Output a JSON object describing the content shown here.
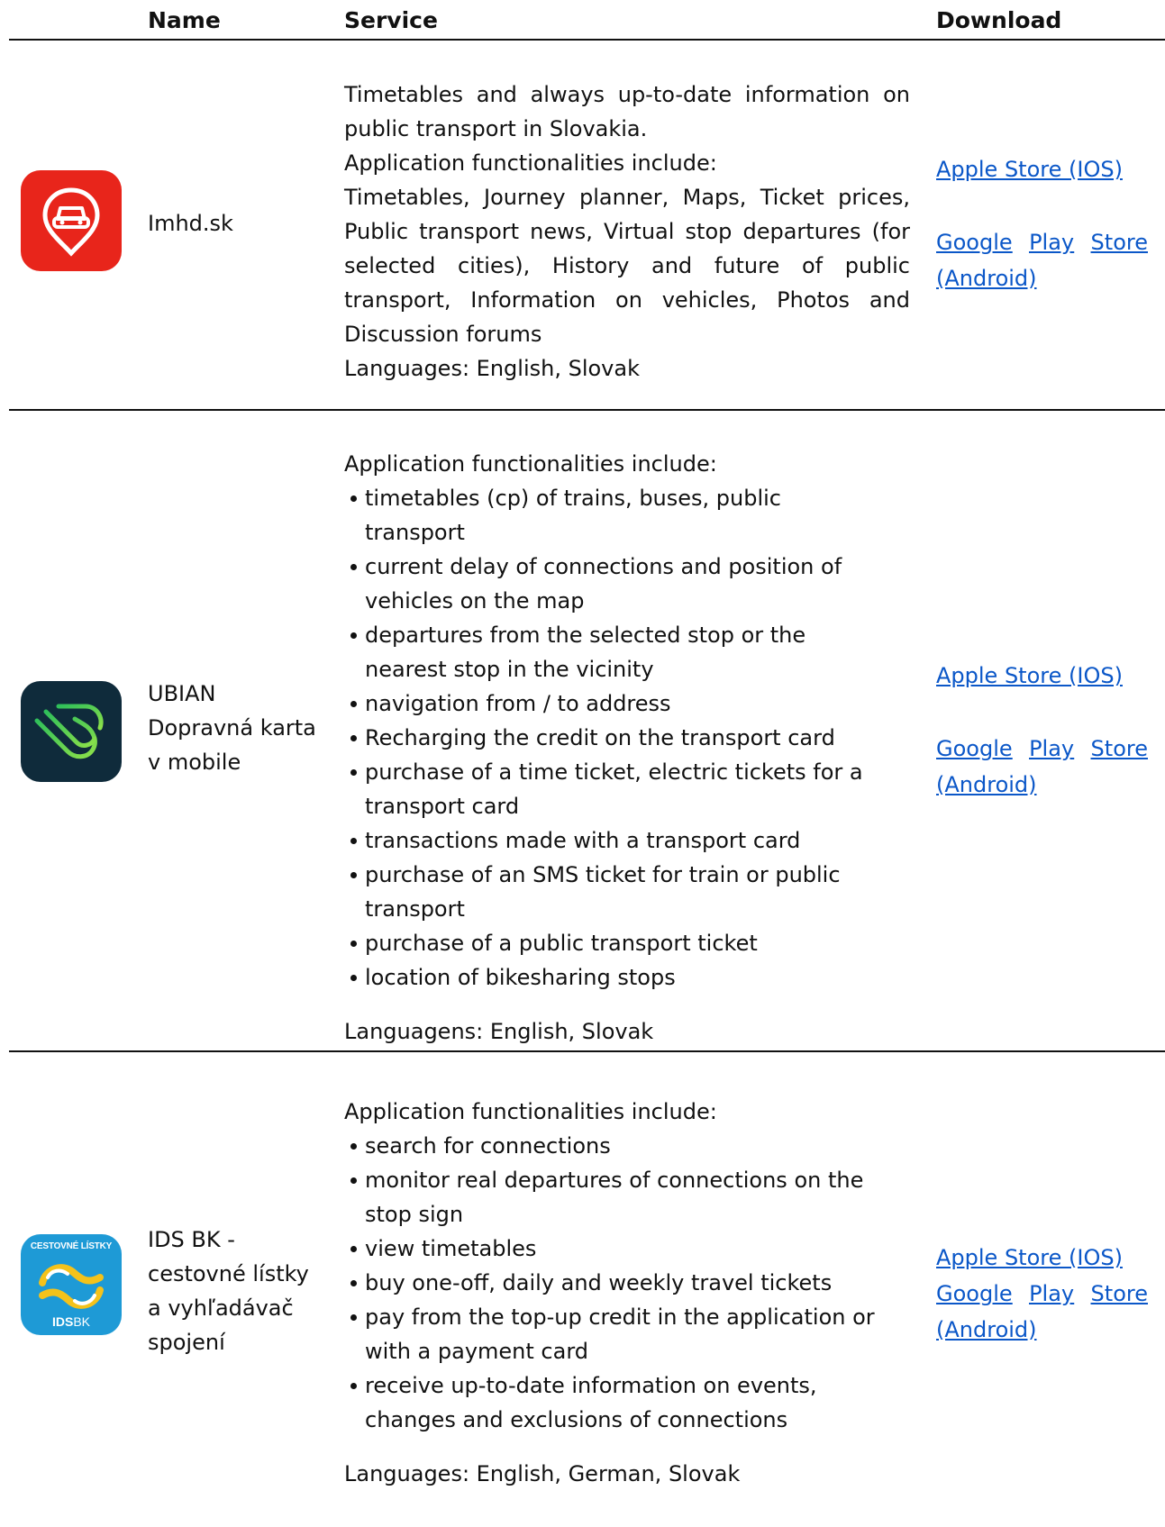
{
  "headers": {
    "name": "Name",
    "service": "Service",
    "download": "Download"
  },
  "colors": {
    "link": "#0b57c8",
    "imhd_icon": "#e8251b",
    "ubian_icon": "#0f2b3b",
    "ids_icon": "#1e9ad6"
  },
  "apps": [
    {
      "icon": "imhd-app-icon",
      "name_lines": [
        "Imhd.sk"
      ],
      "intro": "Timetables and always up-to-date information on public transport in Slovakia.",
      "functionalities": "Application functionalities include:",
      "features_text": "Timetables, Journey planner, Maps, Ticket prices, Public transport news, Virtual stop departures (for selected cities), History and future of public transport, Information on vehicles, Photos and Discussion forums",
      "languages": "Languages: English, Slovak",
      "apple": "Apple Store (IOS)",
      "google_1": [
        "Google",
        "Play",
        "Store"
      ],
      "google_2": "(Android)"
    },
    {
      "icon": "ubian-app-icon",
      "name_lines": [
        "UBIAN",
        "Dopravná karta",
        "v mobile"
      ],
      "functionalities": "Application functionalities include:",
      "features": [
        "timetables (cp) of trains, buses, public transport",
        "current delay of connections and position of vehicles on the map",
        "departures from the selected stop or the nearest stop in the vicinity",
        "navigation from / to address",
        "Recharging the credit on the transport card",
        "purchase of a time ticket, electric tickets for a transport card",
        "transactions made with a transport card",
        "purchase of an SMS ticket for train or public transport",
        "purchase of a public transport ticket",
        "location of bikesharing stops"
      ],
      "languages": "Languagens: English, Slovak",
      "apple": "Apple Store (IOS)",
      "google_1": [
        "Google",
        "Play",
        "Store"
      ],
      "google_2": "(Android)"
    },
    {
      "icon": "ids-bk-app-icon",
      "icon_text_top": "CESTOVNÉ LÍSTKY",
      "icon_text_bottom_bold": "IDS",
      "icon_text_bottom": "BK",
      "name_lines": [
        "IDS BK -",
        "cestovné lístky",
        "a vyhľadávač",
        "spojení"
      ],
      "functionalities": "Application functionalities include:",
      "features": [
        "search for connections",
        "monitor real departures of connections on the stop sign",
        "view timetables",
        "buy one-off, daily and weekly travel tickets",
        "pay from the top-up credit in the application or with a payment card",
        "receive up-to-date information on events, changes and exclusions of connections"
      ],
      "languages": "Languages: English, German, Slovak",
      "apple": "Apple Store (IOS)",
      "google_1": [
        "Google",
        "Play",
        "Store"
      ],
      "google_2": "(Android)"
    }
  ]
}
